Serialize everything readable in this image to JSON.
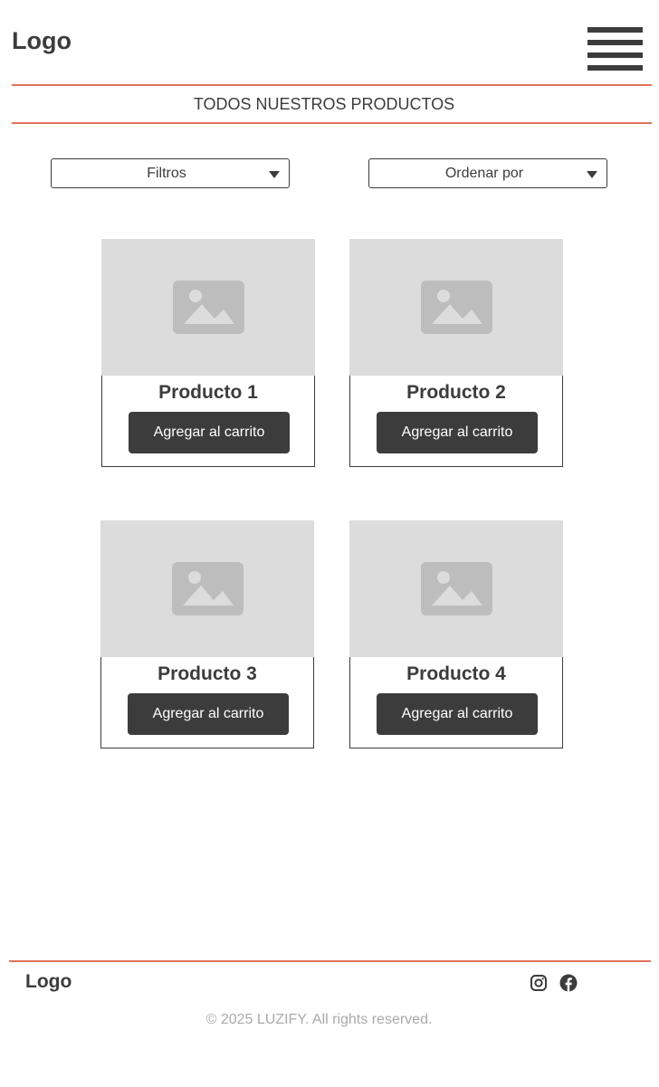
{
  "header": {
    "logo": "Logo",
    "menu_icon": "hamburger-menu-icon"
  },
  "section": {
    "title": "TODOS NUESTROS PRODUCTOS"
  },
  "controls": {
    "filters_label": "Filtros",
    "sort_label": "Ordenar por"
  },
  "products": [
    {
      "name": "Producto 1",
      "button": "Agregar al carrito",
      "image_icon": "image-placeholder-icon"
    },
    {
      "name": "Producto 2",
      "button": "Agregar al carrito",
      "image_icon": "image-placeholder-icon"
    },
    {
      "name": "Producto 3",
      "button": "Agregar al carrito",
      "image_icon": "image-placeholder-icon"
    },
    {
      "name": "Producto 4",
      "button": "Agregar al carrito",
      "image_icon": "image-placeholder-icon"
    }
  ],
  "footer": {
    "logo": "Logo",
    "social_icons": [
      "instagram-icon",
      "facebook-icon"
    ],
    "copyright": "© 2025 LUZIFY. All rights reserved."
  },
  "colors": {
    "accent": "#e0735a",
    "dark": "#3c3c3c",
    "placeholder": "#dcdcdc",
    "muted": "#aaaaaa"
  }
}
